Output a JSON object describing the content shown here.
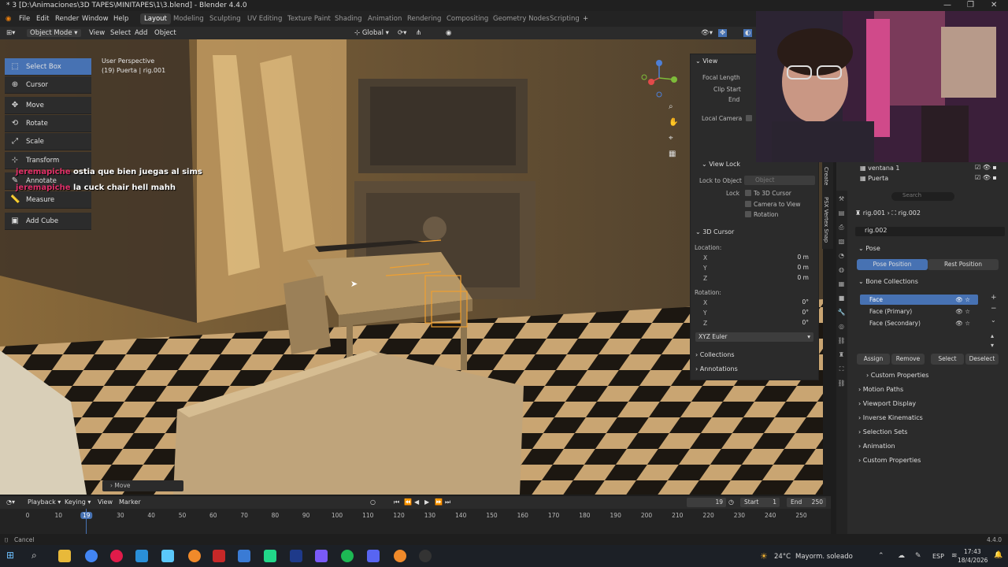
{
  "window": {
    "title": "* 3 [D:\\Animaciones\\3D TAPES\\MINITAPES\\1\\3.blend] - Blender 4.4.0"
  },
  "menu": [
    "File",
    "Edit",
    "Render",
    "Window",
    "Help"
  ],
  "workspaces": [
    "Layout",
    "Modeling",
    "Sculpting",
    "UV Editing",
    "Texture Paint",
    "Shading",
    "Animation",
    "Rendering",
    "Compositing",
    "Geometry Nodes",
    "Scripting"
  ],
  "header3d": {
    "mode": "Object Mode",
    "view": "View",
    "select": "Select",
    "add": "Add",
    "object": "Object",
    "orientation": "Global"
  },
  "viewport": {
    "perspective": "User Perspective",
    "object": "(19) Puerta | rig.001",
    "last_op": "Move"
  },
  "tools": [
    "Select Box",
    "Cursor",
    "Move",
    "Rotate",
    "Scale",
    "Transform",
    "Annotate",
    "Measure",
    "Add Cube"
  ],
  "chat": [
    {
      "user": "jeremapiche",
      "msg": "ostia que bien juegas al sims"
    },
    {
      "user": "jeremapiche",
      "msg": "la cuck chair hell mahh"
    }
  ],
  "npanel": {
    "view": "View",
    "focal_length": "Focal Length",
    "clip_start": "Clip Start",
    "end": "End",
    "local_camera": "Local Camera",
    "view_lock": "View Lock",
    "lock_to_object": "Lock to Object",
    "object_placeholder": "Object",
    "lock": "Lock",
    "to_3d_cursor": "To 3D Cursor",
    "camera_to_view": "Camera to View",
    "rotation_chk": "Rotation",
    "cursor_3d": "3D Cursor",
    "location": "Location:",
    "loc": [
      {
        "a": "X",
        "v": "0 m"
      },
      {
        "a": "Y",
        "v": "0 m"
      },
      {
        "a": "Z",
        "v": "0 m"
      }
    ],
    "rotation": "Rotation:",
    "rot": [
      {
        "a": "X",
        "v": "0°"
      },
      {
        "a": "Y",
        "v": "0°"
      },
      {
        "a": "Z",
        "v": "0°"
      }
    ],
    "euler": "XYZ Euler",
    "collections": "Collections",
    "annotations": "Annotations",
    "tab_create": "Create",
    "tab_psx": "PSX Vertex Snap"
  },
  "outliner": [
    {
      "name": "ventana 1"
    },
    {
      "name": "Puerta"
    }
  ],
  "props": {
    "search_placeholder": "Search",
    "breadcrumb1": "rig.001",
    "breadcrumb2": "rig.002",
    "armature": "rig.002",
    "pose": "Pose",
    "pose_position": "Pose Position",
    "rest_position": "Rest Position",
    "bone_collections": "Bone Collections",
    "collections": [
      "Face",
      "Face (Primary)",
      "Face (Secondary)"
    ],
    "assign": "Assign",
    "remove": "Remove",
    "select": "Select",
    "deselect": "Deselect",
    "custom_props": "Custom Properties",
    "sections": [
      "Motion Paths",
      "Viewport Display",
      "Inverse Kinematics",
      "Selection Sets",
      "Animation",
      "Custom Properties"
    ]
  },
  "timeline": {
    "playback": "Playback",
    "keying": "Keying",
    "view": "View",
    "marker": "Marker",
    "current": "19",
    "start_label": "Start",
    "start": "1",
    "end_label": "End",
    "end": "250",
    "ticks": [
      "0",
      "10",
      "19",
      "30",
      "40",
      "50",
      "60",
      "70",
      "80",
      "90",
      "100",
      "110",
      "120",
      "130",
      "140",
      "150",
      "160",
      "170",
      "180",
      "190",
      "200",
      "210",
      "220",
      "230",
      "240",
      "250"
    ]
  },
  "status": {
    "left": "Cancel",
    "version": "4.4.0"
  },
  "taskbar": {
    "weather_temp": "24°C",
    "weather_desc": "Mayorm. soleado",
    "lang": "ESP",
    "time": "17:43",
    "date": "18/4/2026"
  },
  "colors": {
    "accent": "#4772b3",
    "selection_orange": "#f0a030"
  }
}
